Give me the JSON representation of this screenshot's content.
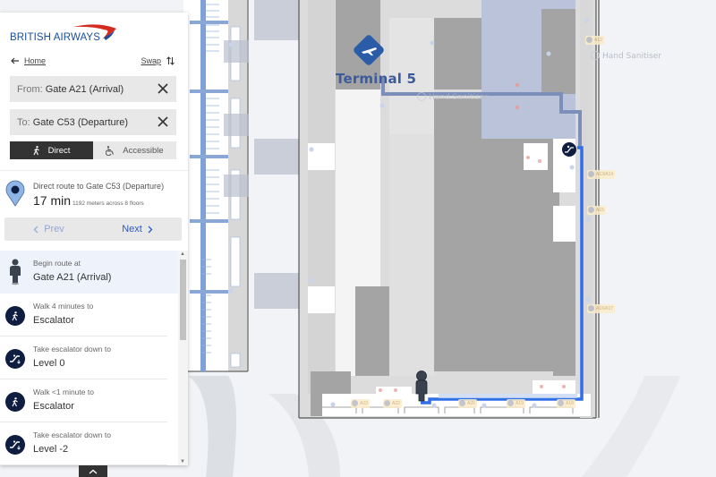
{
  "brand": {
    "name": "BRITISH AIRWAYS",
    "color": "#1b4d9b",
    "swoosh_color": "#d52b1e"
  },
  "nav": {
    "home_label": "Home",
    "swap_label": "Swap"
  },
  "route_fields": {
    "from_prefix": "From:",
    "from_value": "Gate A21 (Arrival)",
    "to_prefix": "To:",
    "to_value": "Gate C53 (Departure)"
  },
  "modes": [
    {
      "label": "Direct",
      "icon": "walking-person-icon",
      "selected": true
    },
    {
      "label": "Accessible",
      "icon": "wheelchair-icon",
      "selected": false
    }
  ],
  "summary": {
    "title": "Direct route to Gate C53 (Departure)",
    "duration": "17 min",
    "details": "1192 meters across 8 floors"
  },
  "pager": {
    "prev_label": "Prev",
    "next_label": "Next"
  },
  "steps": [
    {
      "icon": "person-marker-icon",
      "instruction": "Begin route at",
      "target": "Gate A21 (Arrival)",
      "active": true
    },
    {
      "icon": "walking-icon",
      "instruction": "Walk 4 minutes to",
      "target": "Escalator",
      "active": false
    },
    {
      "icon": "escalator-down-icon",
      "instruction": "Take escalator down to",
      "target": "Level 0",
      "active": false
    },
    {
      "icon": "walking-icon",
      "instruction": "Walk <1 minute to",
      "target": "Escalator",
      "active": false
    },
    {
      "icon": "escalator-down-icon",
      "instruction": "Take escalator down to",
      "target": "Level -2",
      "active": false
    }
  ],
  "map": {
    "terminal_label": "Terminal 5",
    "poi_labels": [
      "Hand Sanitiser",
      "Hand Sanitiser"
    ],
    "gate_labels": [
      "A12",
      "A13/A14",
      "A15",
      "A16/A17",
      "A23",
      "A22",
      "A20",
      "A19",
      "A18"
    ],
    "route_color": "#2f6fe8",
    "route_faded_color": "#7c8fba"
  }
}
